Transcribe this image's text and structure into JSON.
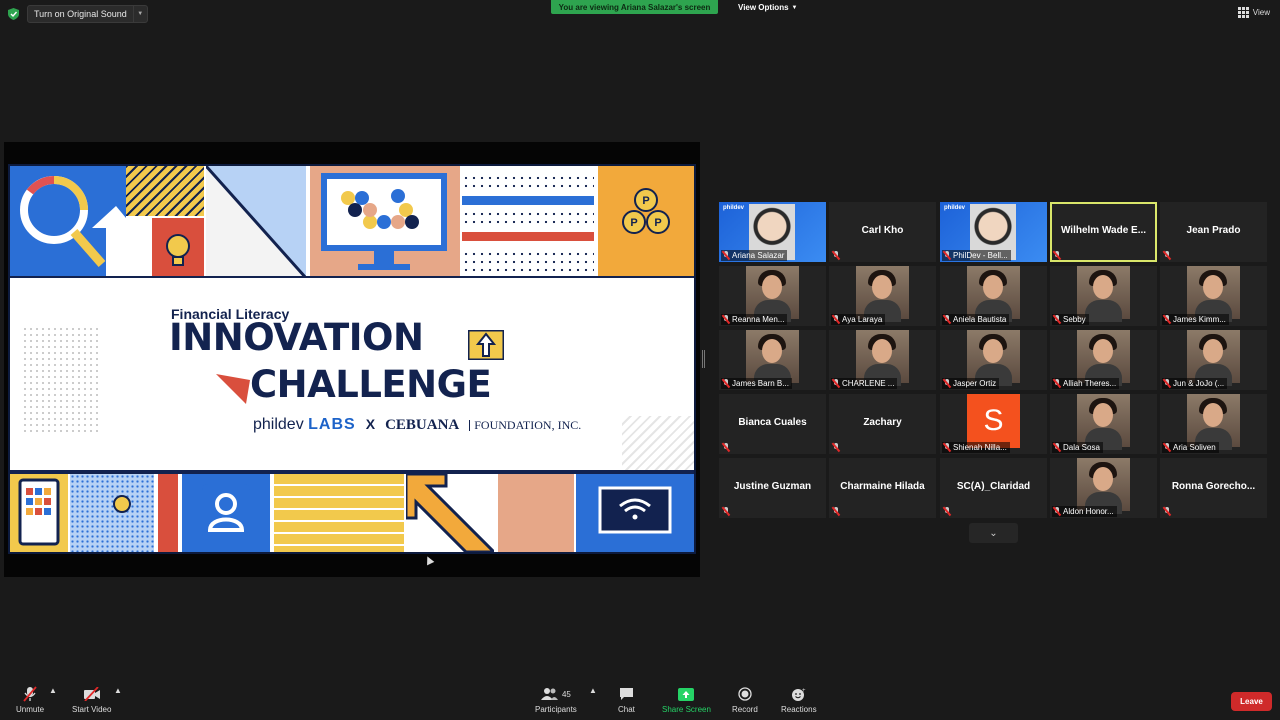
{
  "topbar": {
    "original_sound": "Turn on Original Sound",
    "viewing_banner": "You are viewing Ariana Salazar's screen",
    "view_options": "View Options",
    "view": "View"
  },
  "slide": {
    "subtitle": "Financial Literacy",
    "title_line1": "INNOVATION",
    "title_line2": "CHALLENGE",
    "org1": "phildev",
    "org1_suffix": "LABS",
    "times": "X",
    "org2": "CEBUANA",
    "org2_suffix": "FOUNDATION, INC.",
    "coin_letter": "P"
  },
  "gallery": {
    "phildev_tag": "phildev",
    "tiles": [
      {
        "name": "Ariana Salazar",
        "type": "video-blue"
      },
      {
        "name": "Carl Kho",
        "type": "name"
      },
      {
        "name": "PhilDev - Bell...",
        "type": "video-blue"
      },
      {
        "name": "Wilhelm  Wade  E...",
        "type": "name",
        "active": true
      },
      {
        "name": "Jean Prado",
        "type": "name"
      },
      {
        "name": "Reanna Men...",
        "type": "video"
      },
      {
        "name": "Aya Laraya",
        "type": "video"
      },
      {
        "name": "Aniela Bautista",
        "type": "video"
      },
      {
        "name": "Sebby",
        "type": "video"
      },
      {
        "name": "James Kimm...",
        "type": "video"
      },
      {
        "name": "James Barn B...",
        "type": "video"
      },
      {
        "name": "CHARLENE ...",
        "type": "video"
      },
      {
        "name": "Jasper Ortiz",
        "type": "video"
      },
      {
        "name": "Alliah Theres...",
        "type": "video"
      },
      {
        "name": "Jun & JoJo (...",
        "type": "video"
      },
      {
        "name": "Bianca Cuales",
        "type": "name"
      },
      {
        "name": "Zachary",
        "type": "name"
      },
      {
        "name": "Shienah Nilla...",
        "type": "avatar",
        "letter": "S"
      },
      {
        "name": "Dala Sosa",
        "type": "video"
      },
      {
        "name": "Aria Soliven",
        "type": "video"
      },
      {
        "name": "Justine Guzman",
        "type": "name"
      },
      {
        "name": "Charmaine Hilada",
        "type": "name"
      },
      {
        "name": "SC(A)_Claridad",
        "type": "name"
      },
      {
        "name": "Aldon Honor...",
        "type": "video"
      },
      {
        "name": "Ronna  Gorecho...",
        "type": "name"
      }
    ]
  },
  "toolbar": {
    "unmute": "Unmute",
    "start_video": "Start Video",
    "participants": "Participants",
    "participants_count": "45",
    "chat": "Chat",
    "share_screen": "Share Screen",
    "record": "Record",
    "reactions": "Reactions",
    "leave": "Leave"
  },
  "colors": {
    "background": "#1a1a1a",
    "banner_green": "#2ea44f",
    "active_speaker": "#d9e66a",
    "leave_red": "#cf2a2a",
    "slide_navy": "#12224f"
  }
}
